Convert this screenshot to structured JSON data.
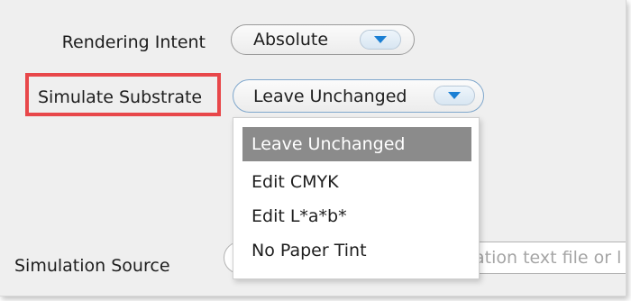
{
  "form": {
    "rendering_intent": {
      "label": "Rendering Intent",
      "value": "Absolute",
      "button_icon": "chevron-down-icon"
    },
    "simulate_substrate": {
      "label": "Simulate Substrate",
      "value": "Leave Unchanged",
      "button_icon": "chevron-down-icon",
      "options": [
        "Leave Unchanged",
        "Edit CMYK",
        "Edit L*a*b*",
        "No Paper Tint"
      ],
      "selected_index": 0
    },
    "simulation_source": {
      "label": "Simulation Source",
      "placeholder_visible": "ation text file or l"
    }
  },
  "colors": {
    "highlight_border": "#e8474a",
    "selected_option_bg": "#8b8b8b",
    "dropdown_arrow": "#1a7fd4"
  }
}
